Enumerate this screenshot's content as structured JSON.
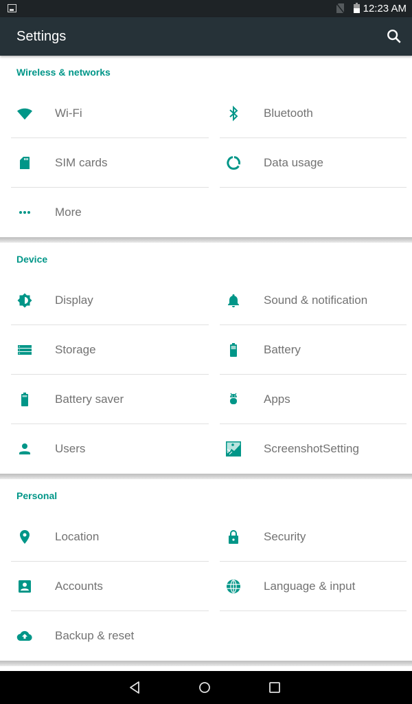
{
  "status_bar": {
    "time": "12:23 AM",
    "icons": [
      "gallery-notification-icon",
      "no-sim-icon",
      "battery-icon"
    ]
  },
  "app_bar": {
    "title": "Settings",
    "search_icon": "search-icon"
  },
  "sections": [
    {
      "title": "Wireless & networks",
      "items": [
        {
          "label": "Wi-Fi",
          "icon": "wifi-icon"
        },
        {
          "label": "Bluetooth",
          "icon": "bluetooth-icon"
        },
        {
          "label": "SIM cards",
          "icon": "sim-card-icon"
        },
        {
          "label": "Data usage",
          "icon": "data-usage-icon"
        },
        {
          "label": "More",
          "icon": "more-horiz-icon"
        }
      ]
    },
    {
      "title": "Device",
      "items": [
        {
          "label": "Display",
          "icon": "brightness-icon"
        },
        {
          "label": "Sound & notification",
          "icon": "bell-icon"
        },
        {
          "label": "Storage",
          "icon": "storage-icon"
        },
        {
          "label": "Battery",
          "icon": "battery-icon"
        },
        {
          "label": "Battery saver",
          "icon": "battery-saver-icon"
        },
        {
          "label": "Apps",
          "icon": "android-icon"
        },
        {
          "label": "Users",
          "icon": "person-icon"
        },
        {
          "label": "ScreenshotSetting",
          "icon": "screenshot-icon"
        }
      ]
    },
    {
      "title": "Personal",
      "items": [
        {
          "label": "Location",
          "icon": "location-pin-icon"
        },
        {
          "label": "Security",
          "icon": "lock-icon"
        },
        {
          "label": "Accounts",
          "icon": "account-box-icon"
        },
        {
          "label": "Language & input",
          "icon": "globe-icon"
        },
        {
          "label": "Backup & reset",
          "icon": "cloud-upload-icon"
        }
      ]
    }
  ],
  "nav_bar": {
    "buttons": [
      "back-icon",
      "home-icon",
      "recents-icon"
    ]
  },
  "colors": {
    "accent": "#009688",
    "app_bar": "#263238",
    "status_bar": "#1e2326",
    "item_text": "#727272"
  }
}
